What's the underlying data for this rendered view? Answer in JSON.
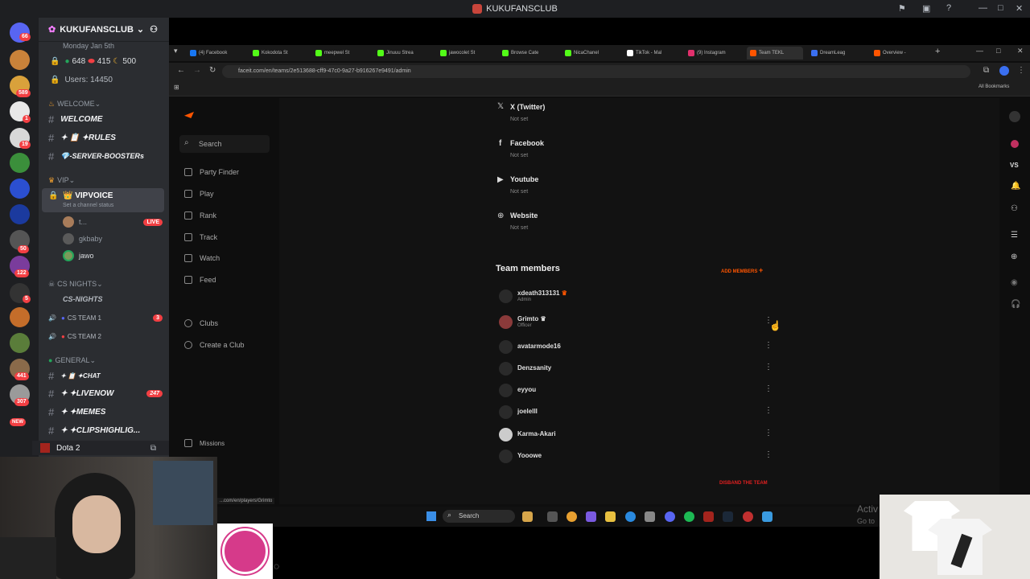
{
  "window": {
    "title": "KUKUFANSCLUB"
  },
  "server": {
    "name": "KUKUFANSCLUB",
    "date_line": "Monday Jan 5th",
    "stats": {
      "online": "648",
      "dnd": "415",
      "idle": "500"
    },
    "users": "Users: 14450"
  },
  "rail_badges": [
    "66",
    "589",
    "1",
    "19",
    "50",
    "122",
    "5",
    "441",
    "307",
    "NEW"
  ],
  "categories": {
    "welcome": "WELCOME",
    "vip": "VIP",
    "cs_nights": "CS NIGHTS",
    "general": "GENERAL"
  },
  "channels": {
    "welcome": "WELCOME",
    "rules": "✦ 📋 ✦RULES",
    "boosters": "💎-SERVER-BOOSTERs",
    "vipvoice": "👑 VIPVOICE",
    "vip_status": "Set a channel status",
    "voice_users": [
      {
        "name": "t...",
        "badge": "LIVE"
      },
      {
        "name": "gkbaby"
      },
      {
        "name": "jawo"
      }
    ],
    "cs_nights": "CS-NIGHTS",
    "cs_team1": "CS TEAM 1",
    "cs_team1_count": "3",
    "cs_team2": "CS TEAM 2",
    "chat": "✦ 📋 ✦CHAT",
    "livenow": "✦ ✦LIVENOW",
    "livenow_count": "247",
    "memes": "✦ ✦MEMES",
    "clips": "✦ ✦CLIPSHIGHLIG..."
  },
  "bottom_activity": "Dota 2",
  "browser": {
    "tabs": [
      {
        "label": "(4) Facebook",
        "color": "#1877f2"
      },
      {
        "label": "Kokodota St",
        "color": "#53fc18"
      },
      {
        "label": "meepwel St",
        "color": "#53fc18"
      },
      {
        "label": "Jinuuu Strea",
        "color": "#53fc18"
      },
      {
        "label": "jawocolet St",
        "color": "#53fc18"
      },
      {
        "label": "Browse Cate",
        "color": "#53fc18"
      },
      {
        "label": "NicaChanel",
        "color": "#53fc18"
      },
      {
        "label": "TikTok - Mal",
        "color": "#111111"
      },
      {
        "label": "(9) Instagram",
        "color": "#e1306c"
      },
      {
        "label": "Team TEKL",
        "color": "#ff5500"
      },
      {
        "label": "DreamLeag",
        "color": "#3a6ff0"
      },
      {
        "label": "Overview - ",
        "color": "#ff5500"
      }
    ],
    "url": "faceit.com/en/teams/2e513688-cff9-47c0-9a27-b916267e9491/admin",
    "bookmarks": "All Bookmarks",
    "status_url": "...com/en/players/Grimto"
  },
  "faceit_nav": {
    "search_placeholder": "Search",
    "items": [
      "Party Finder",
      "Play",
      "Rank",
      "Track",
      "Watch",
      "Feed"
    ],
    "clubs": "Clubs",
    "create_club": "Create a Club",
    "missions": "Missions"
  },
  "socials": [
    {
      "name": "X (Twitter)",
      "value": "Not set",
      "icon": "x-icon"
    },
    {
      "name": "Facebook",
      "value": "Not set",
      "icon": "facebook-icon"
    },
    {
      "name": "Youtube",
      "value": "Not set",
      "icon": "youtube-icon"
    },
    {
      "name": "Website",
      "value": "Not set",
      "icon": "globe-icon"
    }
  ],
  "team": {
    "heading": "Team members",
    "add_members": "ADD MEMBERS",
    "disband": "DISBAND THE TEAM",
    "members": [
      {
        "name": "xdeath313131",
        "role": "Admin"
      },
      {
        "name": "Grimto",
        "role": "Officer"
      },
      {
        "name": "avatarmode16",
        "role": ""
      },
      {
        "name": "Denzsanity",
        "role": ""
      },
      {
        "name": "eyyou",
        "role": ""
      },
      {
        "name": "joelelll",
        "role": ""
      },
      {
        "name": "Karma-Akari",
        "role": ""
      },
      {
        "name": "Yooowe",
        "role": ""
      }
    ]
  },
  "taskbar": {
    "search": "Search"
  },
  "watermark": {
    "line1": "Activ",
    "line2": "Go to"
  },
  "right_rail": {
    "vs": "VS"
  },
  "colors": {
    "accent": "#ff5500",
    "discord_red": "#f23f43",
    "faceit_bg": "#0e0e0e"
  }
}
